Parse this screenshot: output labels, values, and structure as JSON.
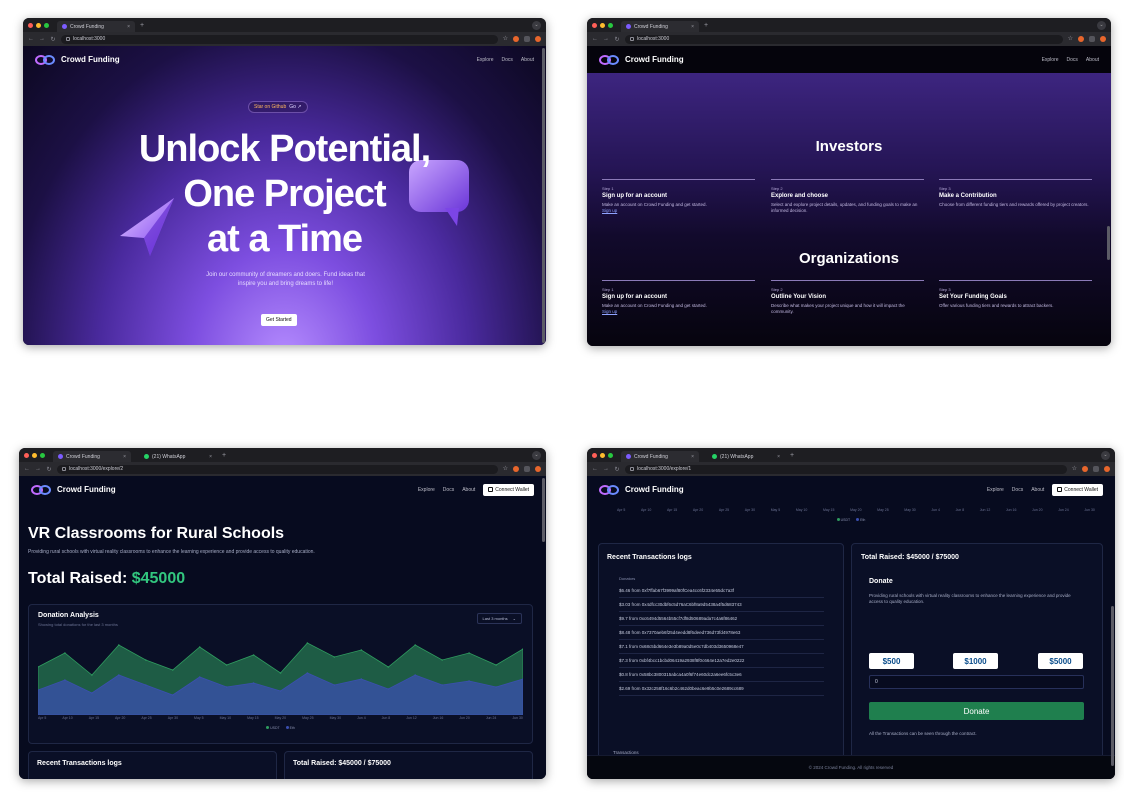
{
  "browser": {
    "tab_home": "Crowd Funding",
    "tab_whatsapp": "(21) WhatsApp",
    "url_home": "localhost:3000",
    "url_project3": "localhost:3000/explore/2",
    "url_project4": "localhost:3000/explore/1"
  },
  "site": {
    "logo": "Crowd Funding",
    "nav": {
      "explore": "Explore",
      "docs": "Docs",
      "about": "About",
      "connect_wallet": "Connect Wallet"
    }
  },
  "hero": {
    "badge_prefix": "Star on",
    "badge_link": "Github",
    "badge_go": "Go ↗",
    "title_line1": "Unlock Potential,",
    "title_line2": "One Project",
    "title_line3": "at a Time",
    "subtitle": "Join our community of dreamers and doers. Fund ideas that inspire you and bring dreams to life!",
    "cta": "Get Started"
  },
  "investors": {
    "title": "Investors",
    "steps": [
      {
        "num": "Step 1",
        "title": "Sign up for an account",
        "desc": "Make an account on Crowd Funding and get started.",
        "link": "Sign up"
      },
      {
        "num": "Step 2",
        "title": "Explore and choose",
        "desc": "Select and explore project details, updates, and funding goals to make an informed decision.",
        "link": ""
      },
      {
        "num": "Step 3",
        "title": "Make a Contribution",
        "desc": "Choose from different funding tiers and rewards offered by project creators.",
        "link": ""
      }
    ]
  },
  "organizations": {
    "title": "Organizations",
    "steps": [
      {
        "num": "Step 1",
        "title": "Sign up for an account",
        "desc": "Make an account on Crowd Funding and get started.",
        "link": "Sign up"
      },
      {
        "num": "Step 2",
        "title": "Outline Your Vision",
        "desc": "Describe what makes your project unique and how it will impact the community.",
        "link": ""
      },
      {
        "num": "Step 3",
        "title": "Set Your Funding Goals",
        "desc": "Offer various funding tiers and rewards to attract backers.",
        "link": ""
      }
    ]
  },
  "project": {
    "title": "VR Classrooms for Rural Schools",
    "description": "Providing rural schools with virtual reality classrooms to enhance the learning experience and provide access to quality education.",
    "raised_label": "Total Raised:",
    "raised_amount": "$45000",
    "chart_title": "Donation Analysis",
    "chart_subtitle": "Showing total donations for the last 3 months",
    "range": "Last 3 months",
    "recent_logs": "Recent Transactions logs",
    "total_raised": "Total Raised: $45000 / $75000"
  },
  "chart_data": {
    "type": "area",
    "title": "Donation Analysis",
    "x": [
      "Apr 5",
      "Apr 10",
      "Apr 15",
      "Apr 20",
      "Apr 25",
      "Apr 30",
      "May 5",
      "May 10",
      "May 15",
      "May 20",
      "May 25",
      "May 30",
      "Jun 4",
      "Jun 8",
      "Jun 12",
      "Jun 16",
      "Jun 20",
      "Jun 24",
      "Jun 30"
    ],
    "series": [
      {
        "name": "USDT",
        "values": [
          48,
          62,
          40,
          70,
          55,
          45,
          68,
          50,
          60,
          42,
          72,
          58,
          65,
          48,
          70,
          55,
          62,
          50,
          66
        ]
      },
      {
        "name": "Eth",
        "values": [
          25,
          35,
          22,
          40,
          30,
          20,
          38,
          28,
          32,
          24,
          42,
          30,
          36,
          26,
          40,
          30,
          34,
          28,
          36
        ]
      }
    ],
    "legend": "bottom-center",
    "colors": {
      "USDT": "#2f9c5f",
      "Eth": "#3b4fb0"
    }
  },
  "transactions": {
    "heading": "Donators",
    "items": [
      "$6.46 from 0xf7ffab67f3999af80fCea4cc6f2334e55dc7a3f",
      "$3.03 from 0x4dfcc30dbf6c5d76aC6bf8a9d5438a4f5d683743",
      "$9.7 from 0xc6494d5564b55cf7df8d50689ada7c4a6f86462",
      "$8.48 from 0x7370aeb6f25d4eedd8f6deed736d73fd4978e63",
      "$7.1 from 0x68c5bd664e3e3b89a0d5e0c7db403d3650968e47",
      "$7.3 from 0xbf4bcc1bcbd06419a2938f8f0c664e12a7ed2e0222",
      "$0.8 from 0x58bc3800315abca4a0f6f74e60dc2a6ee6fc5c3e6",
      "$2.69 from 0x32c258f16c6b2c462d0beac6e9b5c0e2689cc689"
    ],
    "footer": "Transactions"
  },
  "donate": {
    "title": "Donate",
    "description": "Providing rural schools with virtual reality classrooms to enhance the learning experience and provide access to quality education.",
    "amounts": [
      "$500",
      "$1000",
      "$5000"
    ],
    "input_value": "0",
    "button": "Donate",
    "note": "All the Transactions can be seen through the contract."
  },
  "footer": {
    "text": "© 2024 Crowd Funding. All rights reserved"
  }
}
